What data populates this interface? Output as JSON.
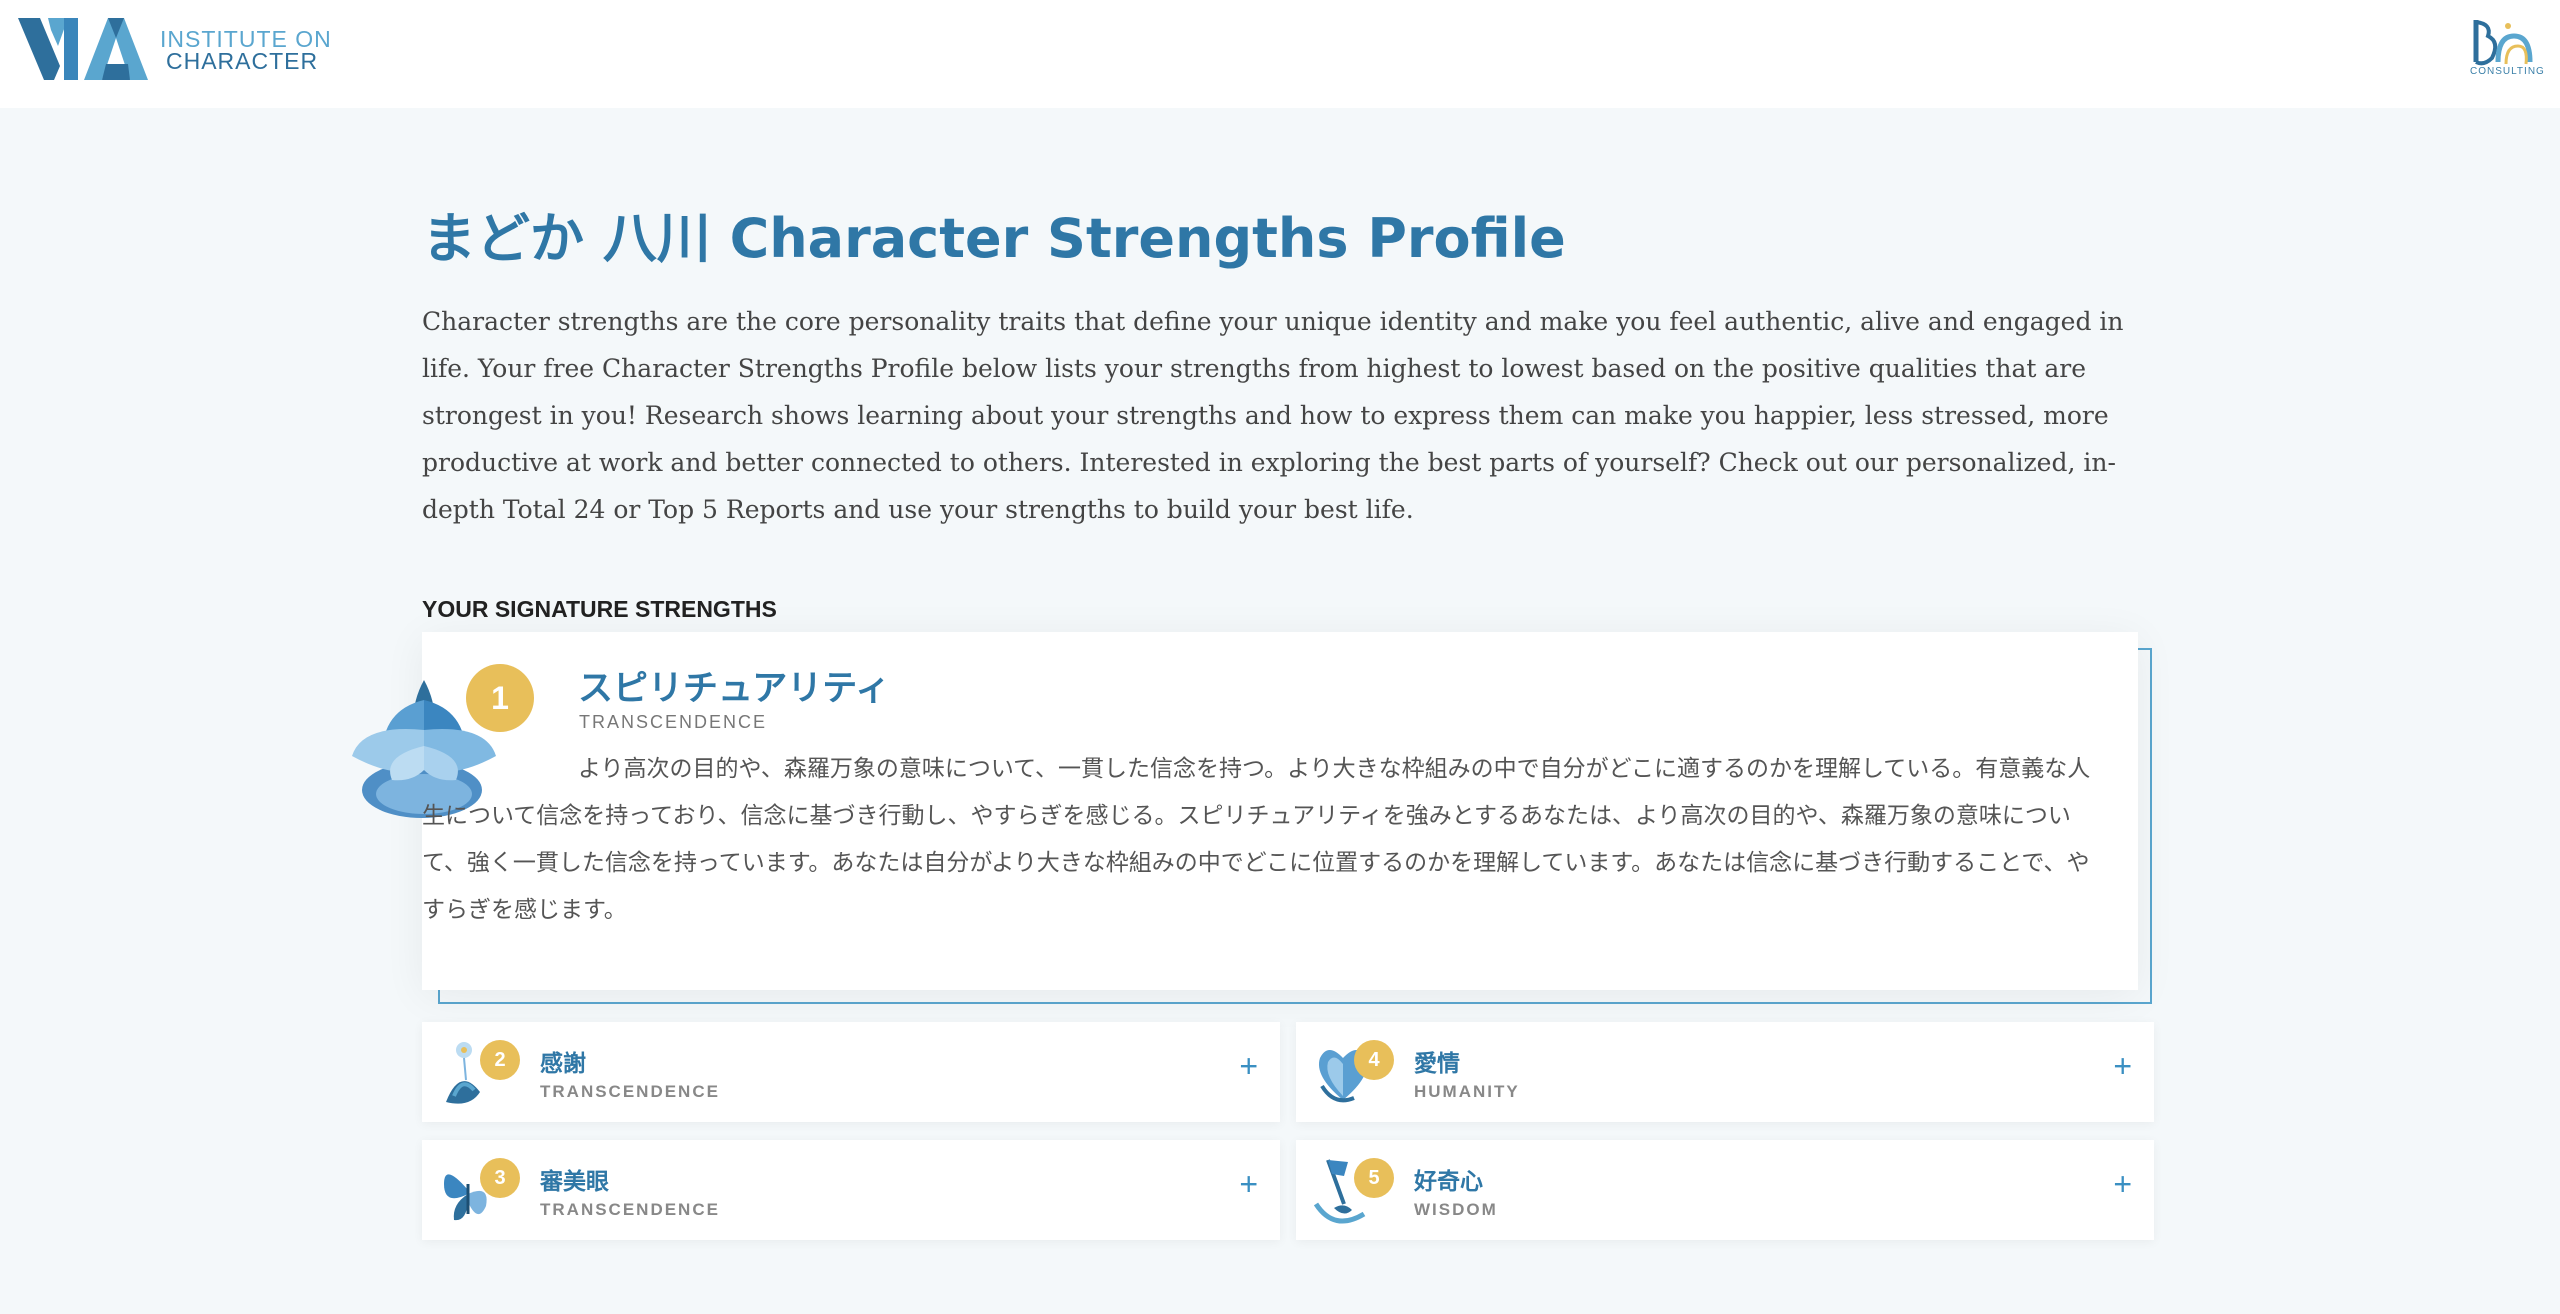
{
  "header": {
    "via_logo": "VIA",
    "via_subtitle_1": "INSTITUTE ON",
    "via_subtitle_2": "CHARACTER",
    "partner_logo_text": "CONSULTING"
  },
  "page": {
    "title": "まどか 八川 Character Strengths Profile",
    "intro": "Character strengths are the core personality traits that define your unique identity and make you feel authentic, alive and engaged in life. Your free Character Strengths Profile below lists your strengths from highest to lowest based on the positive qualities that are strongest in you! Research shows learning about your strengths and how to express them can make you happier, less stressed, more productive at work and better connected to others. Interested in exploring the best parts of yourself? Check out our personalized, in-depth Total 24 or Top 5 Reports and use your strengths to build your best life.",
    "section_label": "YOUR SIGNATURE STRENGTHS"
  },
  "top_strength": {
    "rank": "1",
    "name": "スピリチュアリティ",
    "virtue": "TRANSCENDENCE",
    "icon": "lotus-icon",
    "description": "より高次の目的や、森羅万象の意味について、一貫した信念を持つ。より大きな枠組みの中で自分がどこに適するのかを理解している。有意義な人生について信念を持っており、信念に基づき行動し、やすらぎを感じる。スピリチュアリティを強みとするあなたは、より高次の目的や、森羅万象の意味について、強く一貫した信念を持っています。あなたは自分がより大きな枠組みの中でどこに位置するのかを理解しています。あなたは信念に基づき行動することで、やすらぎを感じます。"
  },
  "strengths": [
    {
      "rank": "2",
      "name": "感謝",
      "virtue": "TRANSCENDENCE",
      "icon": "gratitude-icon",
      "expand": "+"
    },
    {
      "rank": "4",
      "name": "愛情",
      "virtue": "HUMANITY",
      "icon": "heart-icon",
      "expand": "+"
    },
    {
      "rank": "3",
      "name": "審美眼",
      "virtue": "TRANSCENDENCE",
      "icon": "butterfly-icon",
      "expand": "+"
    },
    {
      "rank": "5",
      "name": "好奇心",
      "virtue": "WISDOM",
      "icon": "flag-icon",
      "expand": "+"
    }
  ],
  "colors": {
    "accent_blue": "#2f77a6",
    "rank_gold": "#e8bf5a",
    "outline_blue": "#5aa6cf",
    "background": "#f4f8fa"
  }
}
